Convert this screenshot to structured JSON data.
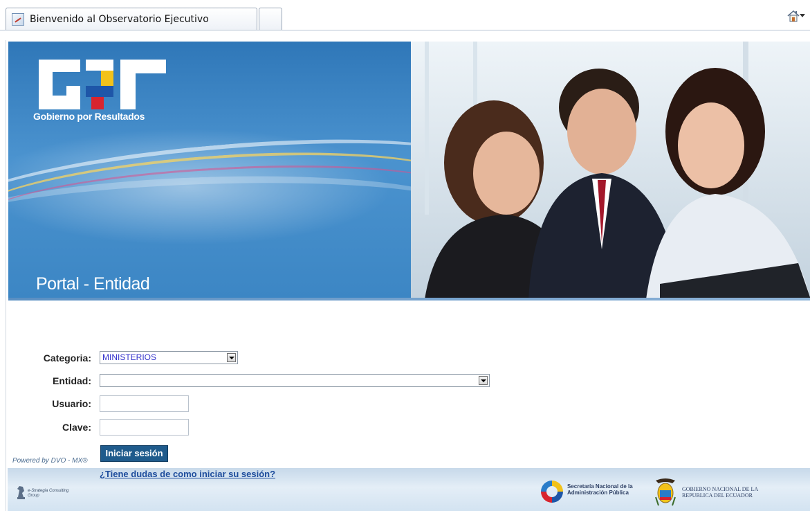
{
  "browser": {
    "tab_title": "Bienvenido al Observatorio Ejecutivo"
  },
  "banner": {
    "logo_tagline": "Gobierno por Resultados",
    "portal_title": "Portal - Entidad"
  },
  "form": {
    "categoria_label": "Categoria:",
    "categoria_value": "MINISTERIOS",
    "entidad_label": "Entidad:",
    "entidad_value": "",
    "usuario_label": "Usuario:",
    "usuario_value": "",
    "clave_label": "Clave:",
    "clave_value": "",
    "login_button": "Iniciar sesión"
  },
  "footer": {
    "powered_by": "Powered by DVO - MX",
    "help_link": "¿Tiene dudas de como iniciar su sesión?",
    "esc_logo_text": "e-Strategia Consulting Group",
    "snap_text": "Secretaría Nacional de la Administración Pública",
    "gobierno_text": "GOBIERNO NACIONAL DE LA REPUBLICA DEL ECUADOR"
  },
  "colors": {
    "banner_blue": "#3c86c4",
    "button_blue": "#1f5b8c",
    "link_blue": "#1d4c9c"
  }
}
